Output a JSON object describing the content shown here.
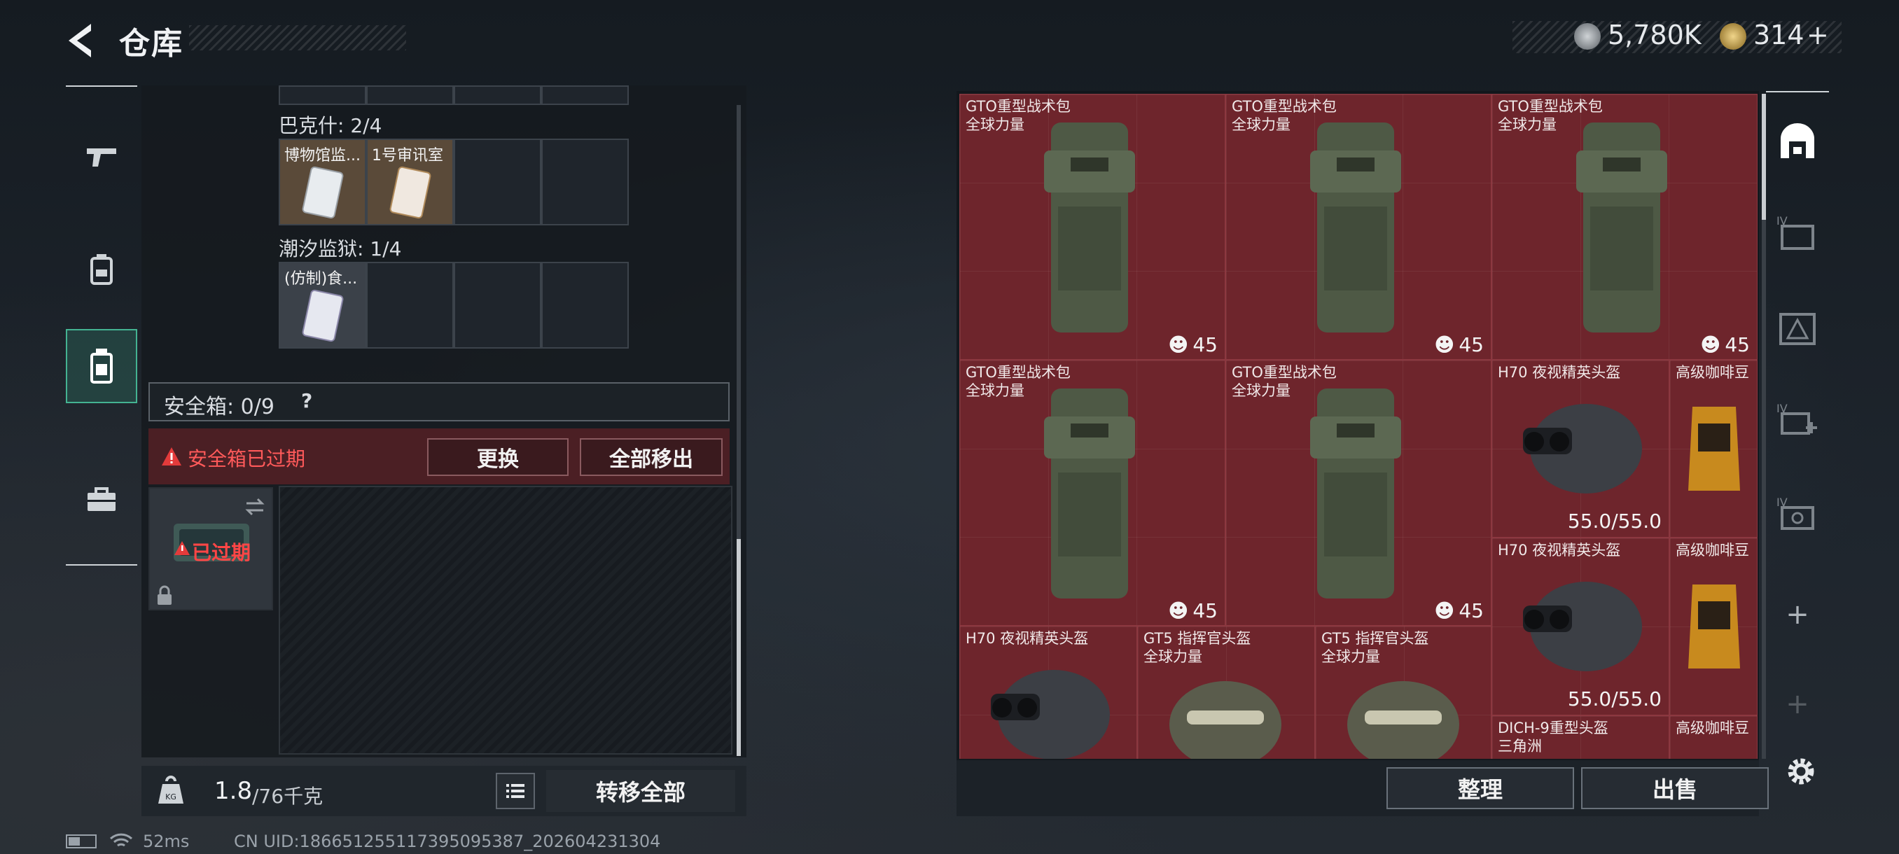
{
  "header": {
    "title": "仓库"
  },
  "currency": {
    "primary": {
      "icon": "silver-coin-icon",
      "value": "5,780K"
    },
    "secondary": {
      "icon": "gold-coin-icon",
      "value": "314",
      "plus": "+"
    }
  },
  "side_nav": [
    {
      "icon": "gun-icon",
      "active": false
    },
    {
      "icon": "backpack-icon",
      "active": false
    },
    {
      "icon": "safe-box-icon",
      "active": true
    },
    {
      "icon": "toolbox-icon",
      "active": false
    }
  ],
  "left_panel": {
    "sections": [
      {
        "label": "巴克什: 2/4",
        "items": [
          "博物馆监...",
          "1号审讯室"
        ]
      },
      {
        "label": "潮汐监狱: 1/4",
        "items": [
          "(仿制)食..."
        ]
      }
    ],
    "safe_box": {
      "label": "安全箱: 0/9",
      "help": "?",
      "expired_text": "安全箱已过期",
      "replace_button": "更换",
      "remove_all_button": "全部移出",
      "tile_status": "已过期"
    },
    "weight": {
      "current": "1.8",
      "max": "/76千克"
    },
    "transfer_all_button": "转移全部"
  },
  "stash": {
    "items": [
      {
        "name": "GTO重型战术包",
        "sub": "全球力量",
        "count": "45"
      },
      {
        "name": "GTO重型战术包",
        "sub": "全球力量",
        "count": "45"
      },
      {
        "name": "GTO重型战术包",
        "sub": "全球力量",
        "count": "45"
      },
      {
        "name": "GTO重型战术包",
        "sub": "全球力量",
        "count": "45"
      },
      {
        "name": "GTO重型战术包",
        "sub": "全球力量",
        "count": "45"
      },
      {
        "name": "H70 夜视精英头盔",
        "durability": "55.0/55.0"
      },
      {
        "name": "高级咖啡豆"
      },
      {
        "name": "H70 夜视精英头盔",
        "durability": "55.0/55.0"
      },
      {
        "name": "高级咖啡豆"
      },
      {
        "name": "H70 夜视精英头盔"
      },
      {
        "name": "GT5 指挥官头盔",
        "sub": "全球力量"
      },
      {
        "name": "GT5 指挥官头盔",
        "sub": "全球力量"
      },
      {
        "name": "DICH-9重型头盔",
        "sub": "三角洲"
      },
      {
        "name": "高级咖啡豆"
      }
    ],
    "sort_button": "整理",
    "sell_button": "出售"
  },
  "right_nav": [
    {
      "icon": "stash-tab-icon",
      "active": true
    },
    {
      "icon": "folder-tab-icon",
      "badge": "IV"
    },
    {
      "icon": "warning-tab-icon"
    },
    {
      "icon": "medical-tab-icon",
      "badge": "IV"
    },
    {
      "icon": "camera-tab-icon",
      "badge": "IV"
    },
    {
      "icon": "plus-icon"
    },
    {
      "icon": "plus-icon-disabled"
    }
  ],
  "status_bar": {
    "ping": "52ms",
    "uid": "CN UID:1866512551173950953​87_202604231304"
  }
}
